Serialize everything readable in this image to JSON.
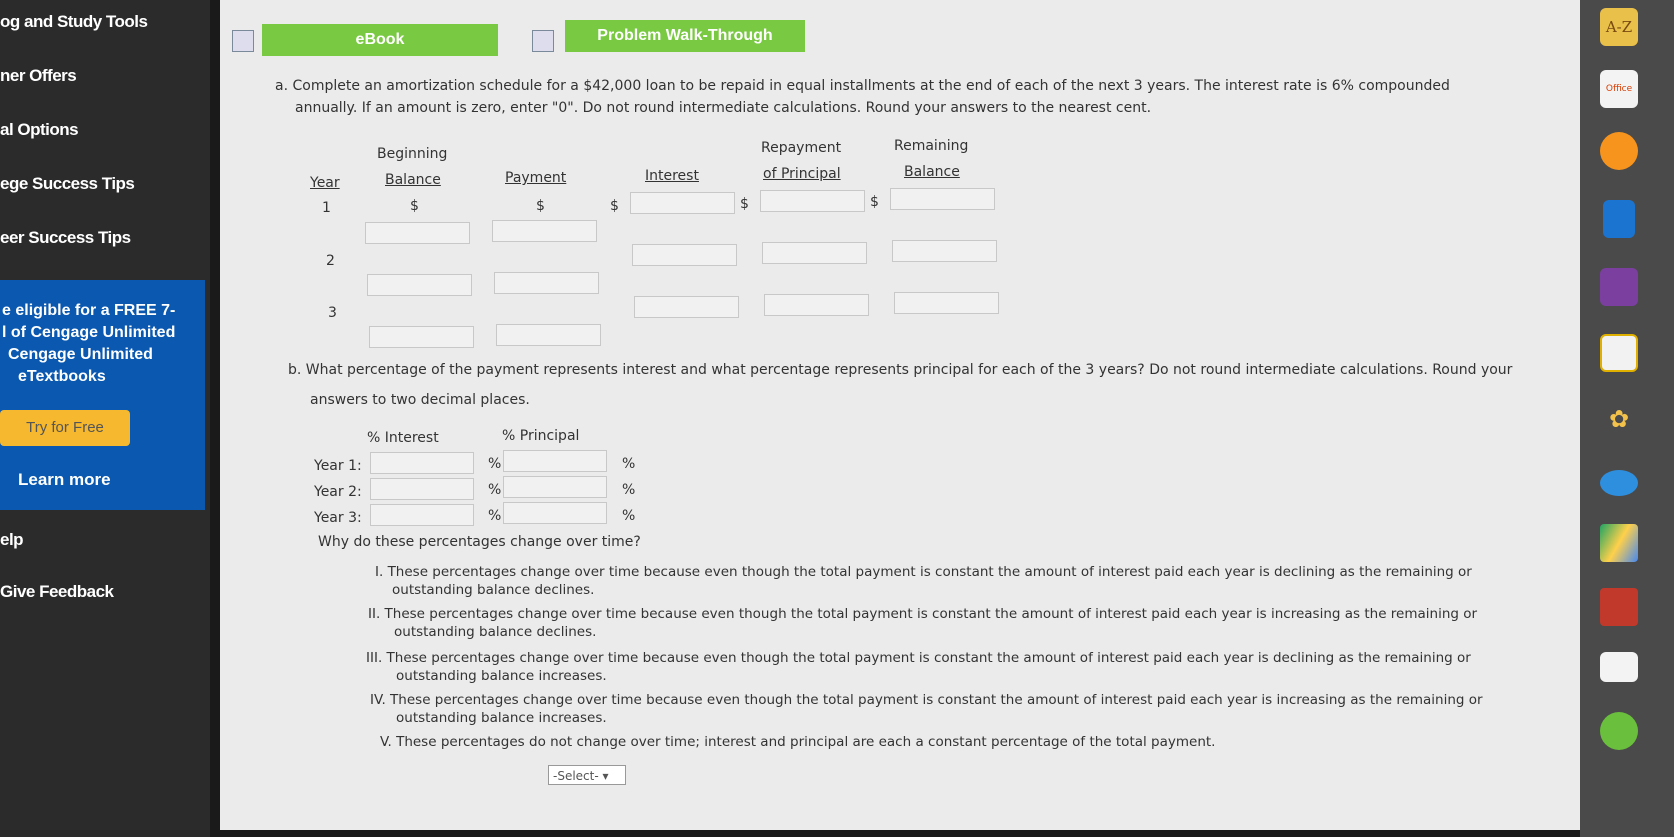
{
  "sidebar": {
    "items": [
      {
        "label": "og and Study Tools"
      },
      {
        "label": "ner Offers"
      },
      {
        "label": "al Options"
      },
      {
        "label": "ege Success Tips"
      },
      {
        "label": "eer Success Tips"
      }
    ],
    "promo": {
      "lines": [
        "e eligible for a FREE 7-",
        "l of Cengage Unlimited",
        "Cengage Unlimited",
        "eTextbooks"
      ],
      "try_label": "Try for Free",
      "learn_label": "Learn more"
    },
    "bottom_items": [
      {
        "label": "elp"
      },
      {
        "label": "Give Feedback"
      }
    ]
  },
  "tabs": {
    "ebook_label": "eBook",
    "walkthrough_label": "Problem Walk-Through"
  },
  "part_a": {
    "line1": "a. Complete an amortization schedule for a $42,000 loan to be repaid in equal installments at the end of each of the next 3 years. The interest rate is 6% compounded",
    "line2": "annually. If an amount is zero, enter \"0\". Do not round intermediate calculations. Round your answers to the nearest cent.",
    "headers": {
      "year": "Year",
      "beginning_top": "Beginning",
      "beginning_bottom": "Balance",
      "payment": "Payment",
      "interest": "Interest",
      "repayment_top": "Repayment",
      "repayment_bottom": "of Principal",
      "remaining_top": "Remaining",
      "remaining_bottom": "Balance"
    },
    "years": [
      "1",
      "2",
      "3"
    ],
    "currency": "$"
  },
  "part_b": {
    "line1": "b. What percentage of the payment represents interest and what percentage represents principal for each of the 3 years? Do not round intermediate calculations. Round your",
    "line2": "answers to two decimal places.",
    "col_interest": "% Interest",
    "col_principal": "% Principal",
    "rows": [
      "Year 1:",
      "Year 2:",
      "Year 3:"
    ],
    "pct": "%",
    "why": "Why do these percentages change over time?",
    "options": [
      {
        "a": "I. These percentages change over time because even though the total payment is constant the amount of interest paid each year is declining as the remaining or",
        "b": "outstanding balance declines."
      },
      {
        "a": "II. These percentages change over time because even though the total payment is constant the amount of interest paid each year is increasing as the remaining or",
        "b": "outstanding balance declines."
      },
      {
        "a": "III. These percentages change over time because even though the total payment is constant the amount of interest paid each year is declining as the remaining or",
        "b": "outstanding balance increases."
      },
      {
        "a": "IV. These percentages change over time because even though the total payment is constant the amount of interest paid each year is increasing as the remaining or",
        "b": "outstanding balance increases."
      },
      {
        "a": "V. These percentages do not change over time; interest and principal are each a constant percentage of the total payment.",
        "b": ""
      }
    ],
    "select_label": "-Select-"
  },
  "taskbar": {
    "az_label": "A-Z",
    "office_label": "Office"
  },
  "colors": {
    "tab_green": "#7ac943",
    "promo_blue": "#0a58b0",
    "try_yellow": "#f5b82e"
  }
}
